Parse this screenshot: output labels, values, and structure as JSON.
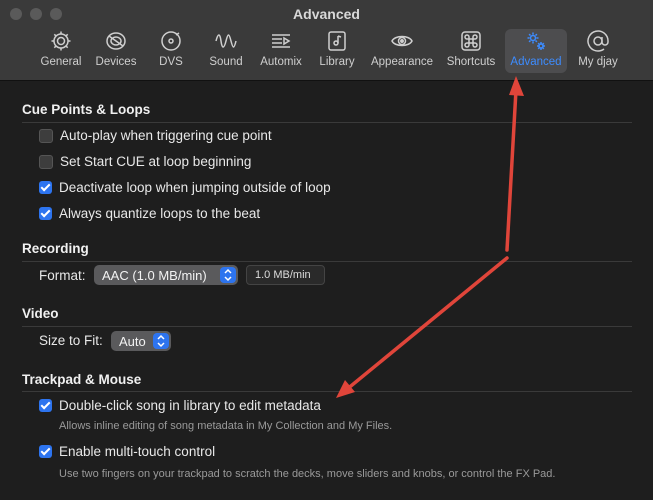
{
  "window": {
    "title": "Advanced"
  },
  "tabs": [
    {
      "label": "General",
      "icon": "gear-icon"
    },
    {
      "label": "Devices",
      "icon": "devices-icon"
    },
    {
      "label": "DVS",
      "icon": "turntable-icon"
    },
    {
      "label": "Sound",
      "icon": "waveform-icon"
    },
    {
      "label": "Automix",
      "icon": "automix-icon"
    },
    {
      "label": "Library",
      "icon": "library-icon"
    },
    {
      "label": "Appearance",
      "icon": "eye-icon"
    },
    {
      "label": "Shortcuts",
      "icon": "command-key-icon"
    },
    {
      "label": "Advanced",
      "icon": "gears-icon"
    },
    {
      "label": "My djay",
      "icon": "at-sign-icon"
    }
  ],
  "active_tab": "Advanced",
  "cue": {
    "title": "Cue Points & Loops",
    "options": [
      {
        "label": "Auto-play when triggering cue point",
        "checked": false
      },
      {
        "label": "Set Start CUE at loop beginning",
        "checked": false
      },
      {
        "label": "Deactivate loop when jumping outside of loop",
        "checked": true
      },
      {
        "label": "Always quantize loops to the beat",
        "checked": true
      }
    ]
  },
  "recording": {
    "title": "Recording",
    "format_label": "Format:",
    "format_value": "AAC (1.0 MB/min)",
    "rate_value": "1.0 MB/min"
  },
  "video": {
    "title": "Video",
    "size_label": "Size to Fit:",
    "size_value": "Auto"
  },
  "trackpad": {
    "title": "Trackpad & Mouse",
    "options": [
      {
        "label": "Double-click song in library to edit metadata",
        "checked": true,
        "help": "Allows inline editing of song metadata in My Collection and My Files."
      },
      {
        "label": "Enable multi-touch control",
        "checked": true,
        "help": "Use two fingers on your trackpad to scratch the decks, move sliders and knobs, or control the FX Pad."
      }
    ]
  },
  "colors": {
    "accent": "#3d8cff",
    "checkbox": "#2d74ef",
    "annotation_arrow": "#e0453a"
  }
}
